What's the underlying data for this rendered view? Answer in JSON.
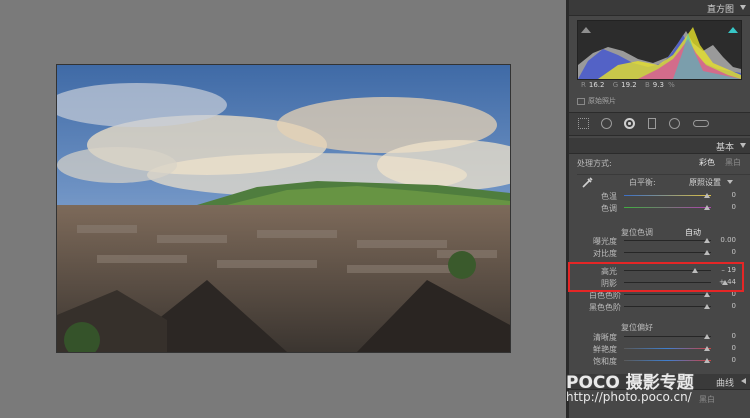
{
  "panel": {
    "histogram_title": "直方图",
    "rgb": {
      "r_label": "R",
      "r_value": "16.2",
      "g_label": "G",
      "g_value": "19.2",
      "b_label": "B",
      "b_value": "9.3",
      "unit": "%"
    },
    "original_photo_label": "原始照片",
    "basic_title": "基本",
    "treatment_label": "处理方式:",
    "color_button": "彩色",
    "bw_button": "黑白",
    "wb_label": "白平衡:",
    "wb_value": "原照设置",
    "sliders_wb": [
      {
        "label": "色温",
        "value": "0"
      },
      {
        "label": "色调",
        "value": "0"
      }
    ],
    "tone_section": "复位色调",
    "auto_button": "自动",
    "sliders_tone": [
      {
        "label": "曝光度",
        "value": "0.00"
      },
      {
        "label": "对比度",
        "value": "0"
      }
    ],
    "sliders_hl": [
      {
        "label": "高光",
        "value": "– 19"
      },
      {
        "label": "阴影",
        "value": "+ 44"
      }
    ],
    "sliders_levels": [
      {
        "label": "白色色阶",
        "value": "0"
      },
      {
        "label": "黑色色阶",
        "value": "0"
      }
    ],
    "presence_section": "复位偏好",
    "sliders_presence": [
      {
        "label": "清晰度",
        "value": "0"
      },
      {
        "label": "鲜艳度",
        "value": "0"
      },
      {
        "label": "饱和度",
        "value": "0"
      }
    ],
    "curve_title": "曲线",
    "bottom_label": "黑白"
  },
  "watermark": {
    "brand": "POCO 摄影专题",
    "url": "http://photo.poco.cn/"
  }
}
